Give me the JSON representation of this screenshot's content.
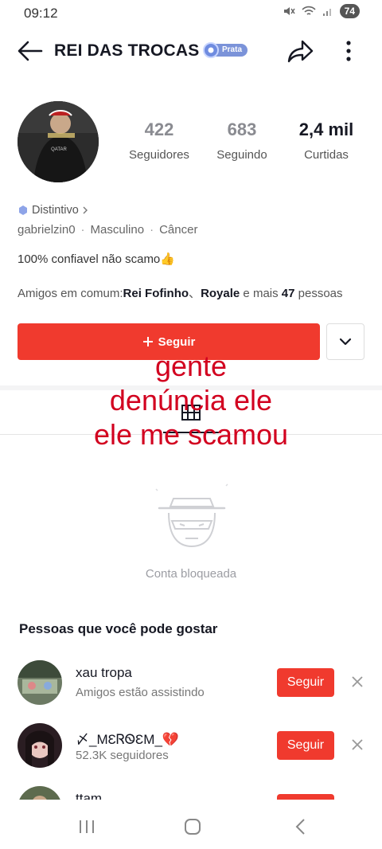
{
  "status_bar": {
    "time": "09:12",
    "battery": "74"
  },
  "header": {
    "title": "REI DAS TROCAS",
    "tier_badge": "Prata"
  },
  "stats": {
    "followers_count": "422",
    "followers_label": "Seguidores",
    "following_count": "683",
    "following_label": "Seguindo",
    "likes_count": "2,4 mil",
    "likes_label": "Curtidas"
  },
  "profile": {
    "distintivo": "Distintivo",
    "username": "gabrielzin0",
    "gender": "Masculino",
    "sign": "Câncer",
    "bio": "100% confiavel não scamo👍",
    "friends_prefix": "Amigos em comum:",
    "friend_1": "Rei Fofinho",
    "friend_sep": "、",
    "friend_2": "Royale",
    "friends_more": " e mais ",
    "friends_count": "47",
    "friends_suffix": " pessoas"
  },
  "actions": {
    "follow_label": "Seguir"
  },
  "overlay": {
    "line1": "gente",
    "line2": "denúncia ele",
    "line3": "ele me scamou"
  },
  "blocked": {
    "label": "Conta bloqueada"
  },
  "suggestions": {
    "title": "Pessoas que você pode gostar",
    "items": [
      {
        "name": "xau tropa",
        "subtitle": "Amigos estão assistindo",
        "button": "Seguir"
      },
      {
        "name": "〆_ΜƐᏒᏫƐΜ_💔",
        "subtitle": "52.3K seguidores",
        "button": "Seguir"
      },
      {
        "name": "ttam",
        "subtitle": "",
        "button": ""
      }
    ]
  },
  "colors": {
    "accent": "#f03a2e",
    "overlay_text": "#d2001f",
    "tier": "#7b93d9"
  },
  "icons": [
    "back-arrow-icon",
    "share-icon",
    "more-vertical-icon",
    "chevron-down-icon",
    "grid-icon",
    "close-icon",
    "plus-icon"
  ]
}
